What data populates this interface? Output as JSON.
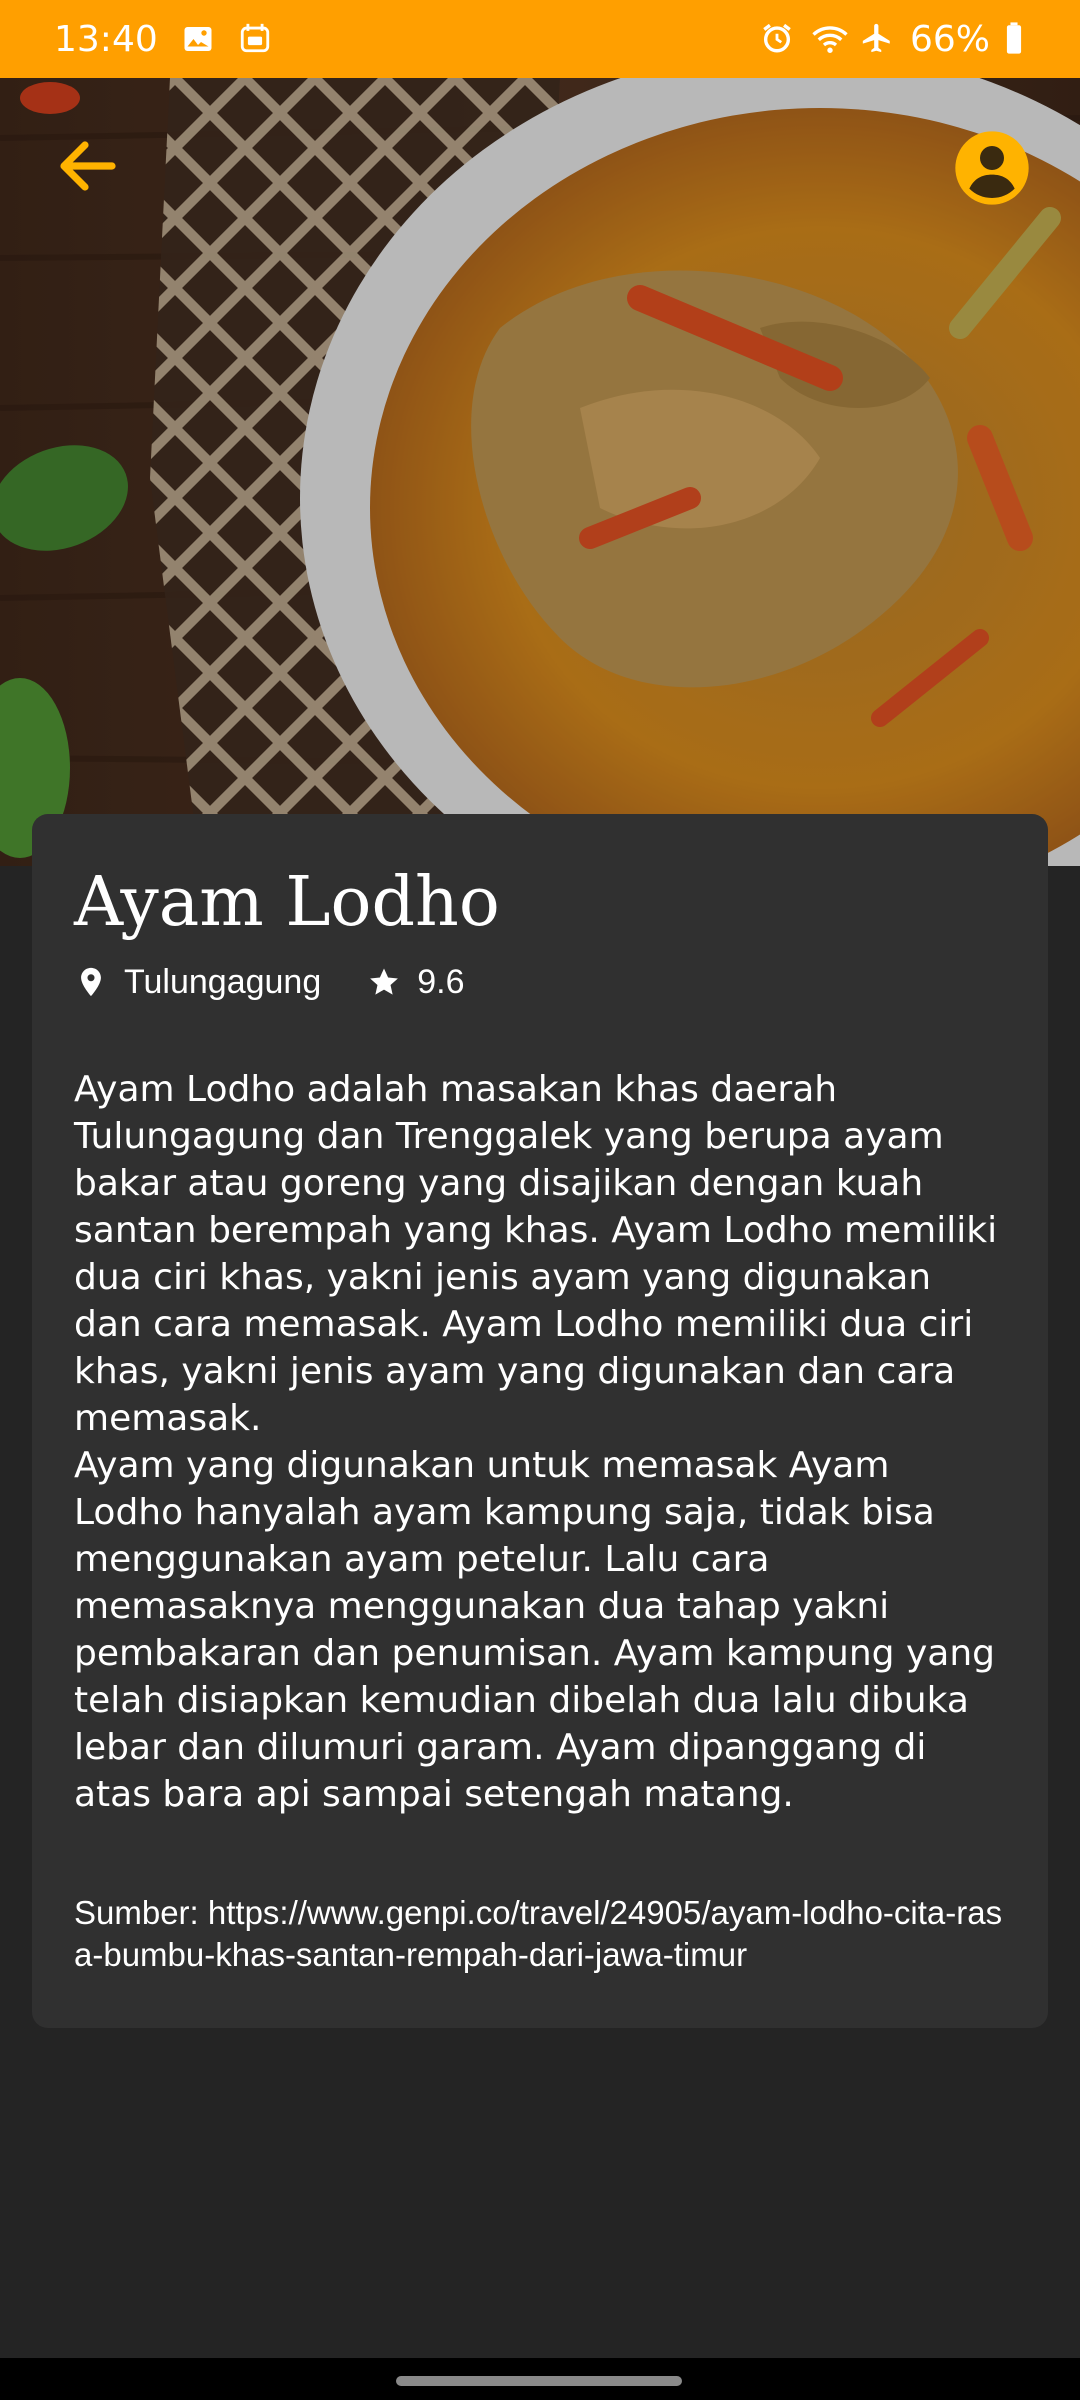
{
  "status_bar": {
    "time": "13:40",
    "battery": "66%",
    "left_icons": [
      "image-icon",
      "calendar-app-icon"
    ],
    "right_icons": [
      "alarm-icon",
      "wifi-icon",
      "airplane-icon",
      "battery-icon"
    ]
  },
  "header": {
    "back_icon": "arrow-left-icon",
    "profile_icon": "account-circle-icon",
    "accent_color": "#ffb300"
  },
  "detail": {
    "title": "Ayam Lodho",
    "location": "Tulungagung",
    "rating": "9.6",
    "location_icon": "map-pin-icon",
    "rating_icon": "star-icon",
    "description": "Ayam Lodho adalah masakan khas daerah Tulungagung dan Trenggalek yang berupa ayam bakar atau goreng yang disajikan dengan kuah santan berempah yang khas. Ayam Lodho memiliki dua ciri khas, yakni jenis ayam yang digunakan dan cara memasak. Ayam Lodho memiliki dua ciri khas, yakni jenis ayam yang digunakan dan cara memasak.\nAyam yang digunakan untuk memasak Ayam Lodho hanyalah ayam kampung saja, tidak bisa menggunakan ayam petelur. Lalu cara memasaknya menggunakan dua tahap yakni pembakaran dan penumisan. Ayam kampung yang telah disiapkan kemudian dibelah dua lalu dibuka lebar dan dilumuri garam. Ayam dipanggang di atas bara api sampai setengah matang.",
    "source": "Sumber: https://www.genpi.co/travel/24905/ayam-lodho-cita-rasa-bumbu-khas-santan-rempah-dari-jawa-timur"
  },
  "colors": {
    "status_bar": "#ff9f00",
    "background": "#242424",
    "card": "#303030"
  }
}
